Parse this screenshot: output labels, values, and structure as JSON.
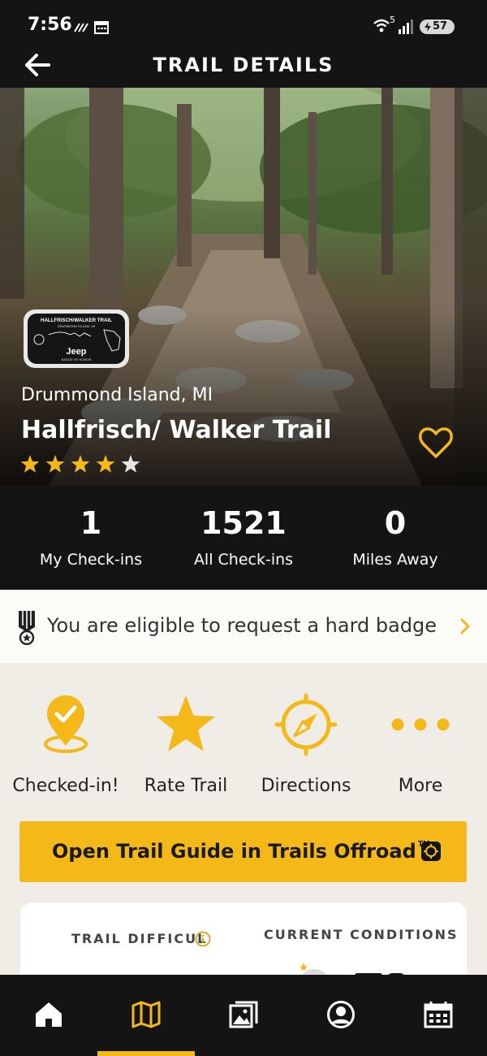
{
  "status_bar": {
    "time": "7:56",
    "battery": "57",
    "wifi_label": "5"
  },
  "header": {
    "title": "TRAIL DETAILS"
  },
  "trail": {
    "location": "Drummond Island, MI",
    "name": "Hallfrisch/ Walker Trail",
    "rating": 4,
    "rating_max": 5,
    "badge": {
      "title": "HALLFRISCH/WALKER TRAIL",
      "subtitle": "DRUMMOND ISLAND, MI",
      "brand": "Jeep",
      "footer": "BADGE OF HONOR"
    }
  },
  "stats": [
    {
      "value": "1",
      "label": "My Check-ins"
    },
    {
      "value": "1521",
      "label": "All Check-ins"
    },
    {
      "value": "0",
      "label": "Miles Away"
    }
  ],
  "badge_banner": {
    "text": "You are eligible to request a hard badge"
  },
  "actions": [
    {
      "label": "Checked-in!",
      "icon": "location-check-icon"
    },
    {
      "label": "Rate Trail",
      "icon": "star-icon"
    },
    {
      "label": "Directions",
      "icon": "compass-icon"
    },
    {
      "label": "More",
      "icon": "more-dots-icon"
    }
  ],
  "guide_button": {
    "label": "Open Trail Guide in Trails Offroad",
    "trademark": "TM"
  },
  "info_card": {
    "difficulty_label": "TRAIL DIFFICUL",
    "conditions_label": "CURRENT CONDITIONS"
  },
  "bottom_nav": [
    {
      "name": "home",
      "icon": "home-icon"
    },
    {
      "name": "map",
      "icon": "map-icon",
      "active": true
    },
    {
      "name": "photos",
      "icon": "photos-icon"
    },
    {
      "name": "profile",
      "icon": "profile-icon"
    },
    {
      "name": "calendar",
      "icon": "calendar-icon"
    }
  ],
  "colors": {
    "accent": "#f4b818",
    "dark": "#141414",
    "background": "#efede6"
  }
}
